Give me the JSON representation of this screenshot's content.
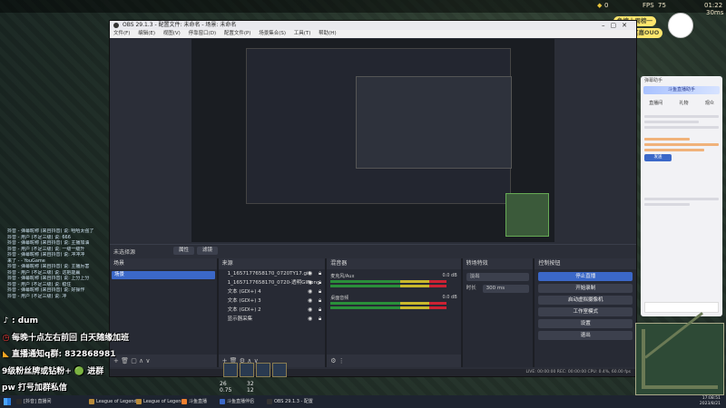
{
  "hud": {
    "ping": "30ms",
    "fps_label": "FPS",
    "fps": "75",
    "clock": "01:22",
    "gold": "0",
    "cs": "0"
  },
  "obs": {
    "title": "OBS 29.1.3 - 配置文件: 未命名 - 场景: 未命名",
    "menu": [
      "文件(F)",
      "编辑(E)",
      "视图(V)",
      "停靠窗口(D)",
      "配置文件(P)",
      "场景集合(S)",
      "工具(T)",
      "帮助(H)"
    ],
    "scene_bar": {
      "label": "未选择源",
      "btn_properties": "属性",
      "btn_filters": "滤镜"
    },
    "docks": {
      "scenes": {
        "title": "场景",
        "items": [
          "场景"
        ]
      },
      "sources": {
        "title": "来源",
        "items": [
          "1_1657177658170_0720TY17.gif",
          "1_1657177658170_0720-透明GIF.png",
          "文本 (GDI+) 4",
          "文本 (GDI+) 3",
          "文本 (GDI+) 2",
          "显示器采集"
        ]
      },
      "mixer": {
        "title": "混音器",
        "channels": [
          {
            "name": "麦克风/Aux",
            "db": "0.0 dB"
          },
          {
            "name": "桌面音频",
            "db": "0.0 dB"
          }
        ]
      },
      "transitions": {
        "title": "转场特效",
        "type": "淡出",
        "duration_label": "时长",
        "duration": "300 ms"
      },
      "controls": {
        "title": "控制按钮",
        "buttons": [
          "停止直播",
          "开始录制",
          "启动虚拟摄像机",
          "工作室模式",
          "设置",
          "退出"
        ]
      }
    },
    "status": "LIVE: 00:00:00   REC: 00:00:00   CPU: 0.4%, 60.00 fps"
  },
  "left_chat": [
    "抖音 - 弹幕昵称 (来自抖音) 说: 哈哈太强了",
    "抖音 - 用户 (不足三级) 说: 666",
    "抖音 - 弹幕昵称 (来自抖音) 说: 主播加油",
    "抖音 - 用户 (不足三级) 说: 一级一级升",
    "抖音 - 弹幕昵称 (来自抖音) 说: 冲冲冲",
    "来了 - - YouGame",
    "抖音 - 弹幕昵称 (来自抖音) 说: 主播厉害",
    "抖音 - 用户 (不足三级) 说: 这把能赢",
    "抖音 - 弹幕昵称 (来自抖音) 说: 上分上分",
    "抖音 - 用户 (不足三级) 说: 稳住",
    "抖音 - 弹幕昵称 (来自抖音) 说: 好操作",
    "抖音 - 用户 (不足三级) 说: 冲"
  ],
  "overlay": [
    {
      "icon": "tiktok-icon",
      "glyph": "♪",
      "text": ": dum"
    },
    {
      "icon": "clock-icon",
      "glyph": "◷",
      "text": "每晚十点左右前回   白天随缘加班"
    },
    {
      "icon": "speaker-icon",
      "glyph": "◣",
      "text": "直播通知q群: 832868981"
    },
    {
      "icon": "wechat-icon",
      "glyph": "",
      "text": "9级粉丝牌或钻粉+ 🟢 进群"
    },
    {
      "icon": "",
      "glyph": "",
      "text": "pw 打号加群私信"
    }
  ],
  "badge": {
    "line1": "鱼塘上周榜一",
    "line2": "深情买嘉OUO"
  },
  "right_panel": {
    "header": "弹幕助手",
    "banner": "斗鱼直播助手",
    "tabs": [
      "直播间",
      "礼物",
      "观众"
    ],
    "button": "发送"
  },
  "taskbar": {
    "items": [
      {
        "label": "[抖音] 直播间",
        "color": "#2a2a2a"
      },
      {
        "label": "League of Legends",
        "color": "#b88a3a"
      },
      {
        "label": "League of Legends",
        "color": "#b88a3a"
      },
      {
        "label": "斗鱼直播",
        "color": "#f08030"
      },
      {
        "label": "斗鱼直播伴侣",
        "color": "#3b68c8"
      },
      {
        "label": "OBS 29.1.3 - 配置",
        "color": "#333"
      }
    ],
    "time": "17:08:51",
    "date": "2023/8/21"
  },
  "game_hud": {
    "kda": "26",
    "level": "32",
    "attack": "0.75",
    "armor": "12"
  }
}
